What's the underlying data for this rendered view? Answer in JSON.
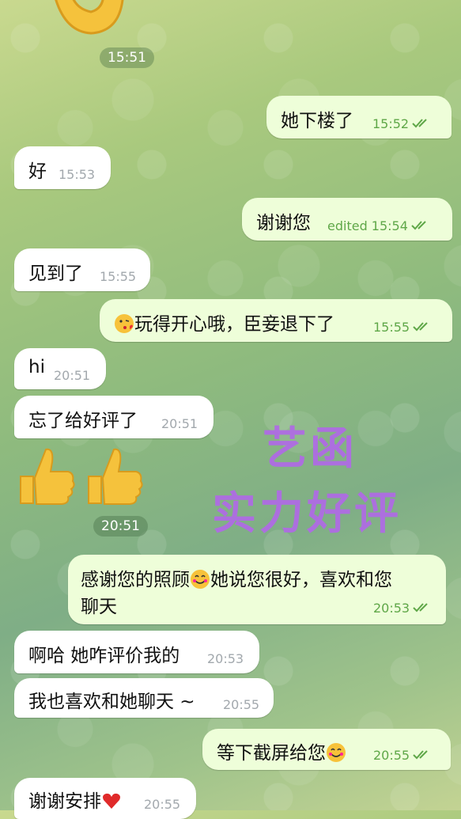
{
  "chat": {
    "messages": [
      {
        "text": "她下楼了",
        "time": "15:52"
      },
      {
        "text": "好",
        "time": "15:53"
      },
      {
        "text": "谢谢您",
        "time": "edited 15:54"
      },
      {
        "text": "见到了",
        "time": "15:55"
      },
      {
        "text": "玩得开心哦，臣妾退下了",
        "time": "15:55"
      },
      {
        "text": "hi",
        "time": "20:51"
      },
      {
        "text": "忘了给好评了",
        "time": "20:51"
      },
      {
        "text": "感谢您的照顾",
        "text2": "她说您很好，喜欢和您",
        "text3": "聊天",
        "time": "20:53"
      },
      {
        "text": "啊哈 她咋评价我的",
        "time": "20:53"
      },
      {
        "text": "我也喜欢和她聊天 ~",
        "time": "20:55"
      },
      {
        "text": "等下截屏给您",
        "time": "20:55"
      },
      {
        "text": "谢谢安排",
        "time": "20:55"
      }
    ],
    "sticker_times": [
      "15:51",
      "20:51"
    ]
  },
  "watermark": {
    "line1": "艺函",
    "line2": "实力好评"
  },
  "colors": {
    "incoming": "#ffffff",
    "outgoing": "#eefed9",
    "tick": "#5fa748",
    "watermark": "#b06ae6"
  },
  "icons": [
    "double-check-icon",
    "kiss-emoji-icon",
    "smile-emoji-icon",
    "heart-emoji-icon",
    "thumbs-up-icon",
    "ok-hand-icon"
  ]
}
